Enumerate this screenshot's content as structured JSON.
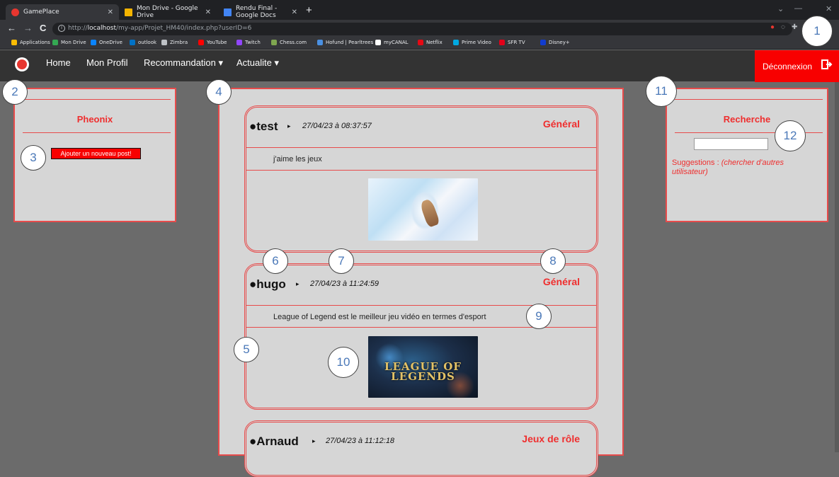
{
  "browser": {
    "tabs": [
      {
        "label": "GamePlace",
        "fav": "#e8362f"
      },
      {
        "label": "Mon Drive - Google Drive",
        "fav": "#f4b400"
      },
      {
        "label": "Rendu Final - Google Docs",
        "fav": "#4285f4"
      }
    ],
    "new_tab": "+",
    "url_prefix": "http://",
    "url_host": "localhost",
    "url_path": "/my-app/Projet_HM40/index.php?userID=6",
    "bookmarks": [
      {
        "label": "Applications",
        "color": "#fbbc04"
      },
      {
        "label": "Mon Drive",
        "color": "#34a853"
      },
      {
        "label": "OneDrive",
        "color": "#0a84ff"
      },
      {
        "label": "outlook",
        "color": "#0072c6"
      },
      {
        "label": "Zimbra",
        "color": "#bdc1c6"
      },
      {
        "label": "YouTube",
        "color": "#ff0000"
      },
      {
        "label": "Twitch",
        "color": "#9146ff"
      },
      {
        "label": "Chess.com",
        "color": "#7fa650"
      },
      {
        "label": "Hofund | Pearltrees",
        "color": "#4a90e2"
      },
      {
        "label": "myCANAL",
        "color": "#ffffff"
      },
      {
        "label": "Netflix",
        "color": "#e50914"
      },
      {
        "label": "Prime Video",
        "color": "#00a8e1"
      },
      {
        "label": "SFR TV",
        "color": "#e2001a"
      },
      {
        "label": "Disney+",
        "color": "#113ccf"
      }
    ]
  },
  "site": {
    "nav": {
      "home": "Home",
      "profile": "Mon Profil",
      "recommendation": "Recommandation ▾",
      "news": "Actualite ▾",
      "logout": "Déconnexion"
    },
    "left_panel": {
      "title": "Pheonix",
      "add_post": "Ajouter un nouveau post!"
    },
    "right_panel": {
      "title": "Recherche",
      "suggestions_label": "Suggestions : ",
      "suggestions_hint": "(chercher d'autres utilisateur)"
    },
    "posts": [
      {
        "user": "●test",
        "date": "27/04/23 à 08:37:57",
        "category": "Général",
        "text": "j'aime les jeux"
      },
      {
        "user": "●hugo",
        "date": "27/04/23 à 11:24:59",
        "category": "Général",
        "text": "League of Legend est le meilleur jeu vidéo en termes d'esport",
        "image_text": "LEAGUE OF LEGENDS"
      },
      {
        "user": "●Arnaud",
        "date": "27/04/23 à 11:12:18",
        "category": "Jeux de rôle"
      }
    ],
    "arrow": "▸"
  },
  "annotations": [
    "1",
    "2",
    "3",
    "4",
    "5",
    "6",
    "7",
    "8",
    "9",
    "10",
    "11",
    "12"
  ],
  "colors": {
    "accent": "#ef2e2e",
    "logout_bg": "#f80000",
    "panel_bg": "#d6d6d6",
    "page_bg": "#6b6b6b"
  }
}
